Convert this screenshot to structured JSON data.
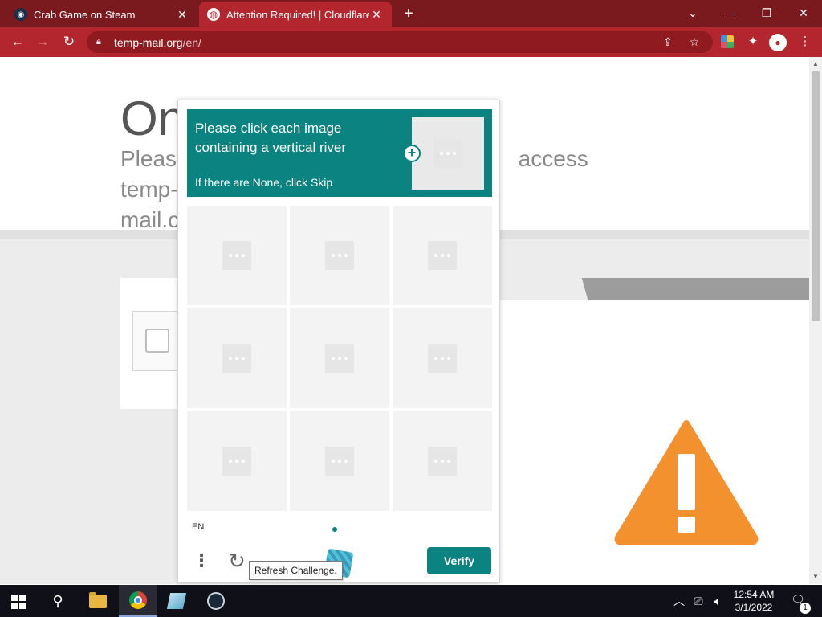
{
  "browser": {
    "tabs": [
      {
        "title": "Crab Game on Steam",
        "active": false,
        "icon": "steam-icon"
      },
      {
        "title": "Attention Required! | Cloudflare",
        "active": true,
        "icon": "globe-icon"
      }
    ],
    "new_tab_glyph": "+",
    "window_controls": {
      "tab_search": "⌄",
      "minimize": "—",
      "restore": "❐",
      "close": "✕"
    },
    "nav": {
      "back": "←",
      "forward": "→",
      "reload": "↻"
    },
    "address": {
      "host": "temp-mail.org",
      "path": "/en/"
    },
    "toolbar_icons": [
      "share-icon",
      "bookmark-star-icon",
      "extension-color-icon",
      "puzzle-extensions-icon",
      "profile-avatar-icon",
      "kebab-menu-icon"
    ],
    "theme_color": "#b3262d"
  },
  "page": {
    "title": "On",
    "subtitle_line1": "Please",
    "subtitle_right": "access temp-",
    "subtitle_line2": "mail.c"
  },
  "captcha": {
    "prompt": "Please click each image containing a vertical river",
    "prompt_sub": "If there are None, click Skip",
    "language": "EN",
    "tooltip": "Refresh Challenge.",
    "verify_label": "Verify",
    "accent_color": "#0b8481",
    "grid_cells": 9
  },
  "taskbar": {
    "pinned": [
      "file-explorer-icon",
      "chrome-icon",
      "game-icon",
      "steam-icon"
    ],
    "active_app": "chrome-icon",
    "time": "12:54 AM",
    "date": "3/1/2022",
    "notification_count": "1"
  }
}
